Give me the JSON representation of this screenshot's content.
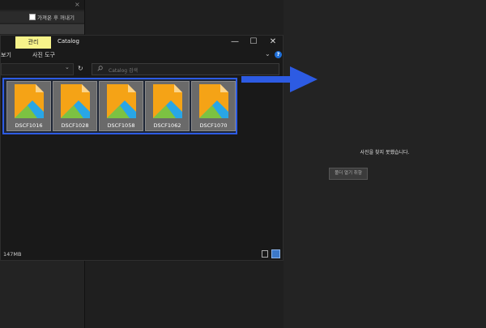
{
  "left_panel": {
    "close_glyph": "×",
    "option_label": "가져온 후 꺼내기"
  },
  "explorer": {
    "tabs": [
      {
        "label": "관리",
        "highlight_color": "#f7f38a"
      },
      {
        "label": "Catalog"
      }
    ],
    "window_controls": {
      "minimize": "—",
      "maximize": "☐",
      "close": "✕"
    },
    "ribbon": {
      "view_label": "보기",
      "tools_label": "사진 도구",
      "help": "?"
    },
    "refresh_glyph": "↻",
    "search_placeholder": "Catalog 검색",
    "files": [
      {
        "name": "DSCF1016"
      },
      {
        "name": "DSCF1028"
      },
      {
        "name": "DSCF1058"
      },
      {
        "name": "DSCF1062"
      },
      {
        "name": "DSCF1070"
      }
    ],
    "status_text": "147MB"
  },
  "right_panel": {
    "message": "사진을 찾지 못했습니다.",
    "button_label": "폴더 열기 취향"
  },
  "colors": {
    "selection_border": "#2d5be3",
    "arrow": "#2d5be3",
    "thumb_orange": "#f5a316",
    "thumb_blue": "#29a6e6",
    "thumb_green": "#7cc242"
  }
}
